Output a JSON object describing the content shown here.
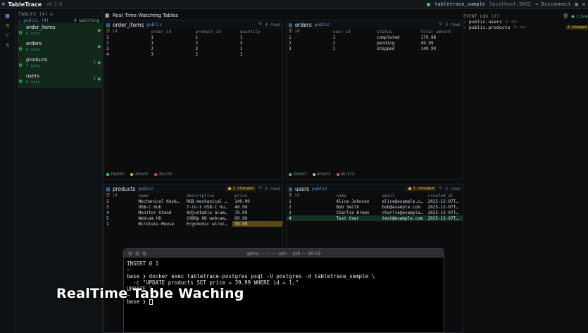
{
  "app": {
    "name": "TableTrace",
    "version": "v0.1.0",
    "connection_db": "tabletrace_sample",
    "connection_host": "localhost:5432",
    "disconnect_label": "Disconnect"
  },
  "sidebar": {
    "header": "TABLES (4)",
    "schema_label": "public (4)",
    "watching_label": "4 watching",
    "tables": [
      {
        "name": "order_items",
        "cols": "6 cols",
        "count": ""
      },
      {
        "name": "orders",
        "cols": "6 cols",
        "count": ""
      },
      {
        "name": "products",
        "cols": "7 cols",
        "count": "1"
      },
      {
        "name": "users",
        "cols": "5 cols",
        "count": "1"
      }
    ]
  },
  "main": {
    "title": "Real Time Watching Tables"
  },
  "panels": {
    "order_items": {
      "name": "order_items",
      "schema": "public",
      "rows_label": "4 rows",
      "columns": [
        "id",
        "order_id",
        "product_id",
        "quantity"
      ],
      "rows": [
        [
          "1",
          "1",
          "1",
          "1"
        ],
        [
          "2",
          "1",
          "3",
          "3"
        ],
        [
          "3",
          "2",
          "3",
          "1"
        ],
        [
          "4",
          "3",
          "2",
          "1"
        ]
      ]
    },
    "orders": {
      "name": "orders",
      "schema": "public",
      "rows_label": "3 rows",
      "columns": [
        "id",
        "user_id",
        "status",
        "total_amount"
      ],
      "rows": [
        [
          "1",
          "1",
          "completed",
          "179.98"
        ],
        [
          "2",
          "2",
          "pending",
          "49.99"
        ],
        [
          "3",
          "1",
          "shipped",
          "149.99"
        ]
      ]
    },
    "products": {
      "name": "products",
      "schema": "public",
      "changed_label": "1 changed",
      "rows_label": "5 rows",
      "columns": [
        "id",
        "name",
        "description",
        "price"
      ],
      "rows": [
        [
          "2",
          "Mechanical Keyb…",
          "RGB mechanical …",
          "149.99"
        ],
        [
          "3",
          "USB-C Hub",
          "7-in-1 USB-C hu…",
          "49.99"
        ],
        [
          "4",
          "Monitor Stand",
          "Adjustable alum…",
          "79.99"
        ],
        [
          "5",
          "Webcam HD",
          "1080p HD webcam…",
          "69.99"
        ],
        [
          "1",
          "Wireless Mouse",
          "Ergonomic wirel…",
          "39.99"
        ]
      ]
    },
    "users": {
      "name": "users",
      "schema": "public",
      "changed_label": "1 changed",
      "rows_label": "4 rows",
      "columns": [
        "id",
        "name",
        "email",
        "created_at"
      ],
      "rows": [
        [
          "1",
          "Alice Johnson",
          "alice@example.c…",
          "2025-12-07T1…"
        ],
        [
          "2",
          "Bob Smith",
          "bob@example.com",
          "2025-12-07T1…"
        ],
        [
          "3",
          "Charlie Brown",
          "charlie@example…",
          "2025-12-07T1…"
        ],
        [
          "4",
          "Test User",
          "test@example.com",
          "2025-12-07T1…"
        ]
      ]
    },
    "legend": {
      "insert": "INSERT",
      "update": "UPDATE",
      "delete": "DELETE"
    }
  },
  "event_log": {
    "header": "EVENT LOG (2)",
    "live_label": "Live",
    "events": [
      {
        "table": "public.users",
        "ago": "5s ago",
        "badge": ""
      },
      {
        "table": "public.products",
        "ago": "3s ago",
        "badge": "1 changed"
      }
    ]
  },
  "terminal": {
    "title": "gtms — ~ — -zsh · -zsh — 90×9",
    "lines": [
      "INSERT 0 1",
      "",
      "~",
      "base ❯ docker exec tabletrace-postgres psql -U postgres -d tabletrace_sample \\",
      "  -c \"UPDATE products SET price = 39.99 WHERE id = 1;\"",
      "UPDATE 1",
      "",
      "~",
      "base ❯ "
    ]
  },
  "caption": "RealTime Table Waching",
  "colors": {
    "accent_blue": "#5aa0e6",
    "accent_green": "#3ecf6a",
    "update_yellow": "#e8b73a",
    "delete_red": "#e0525a"
  }
}
